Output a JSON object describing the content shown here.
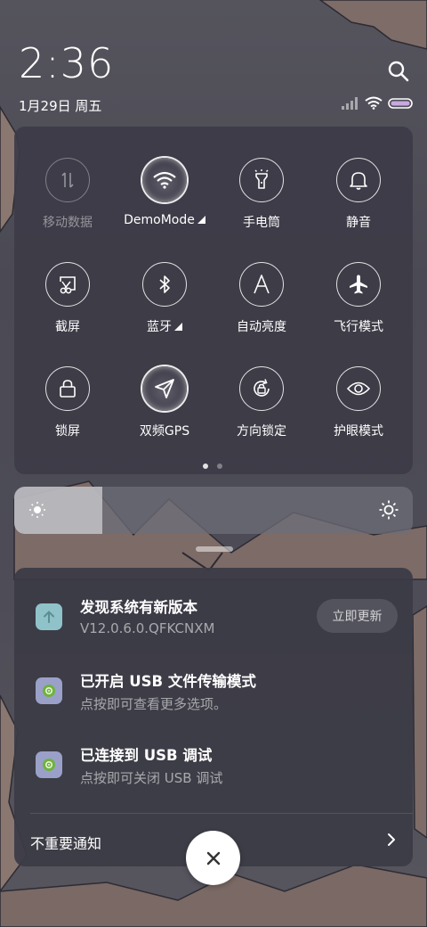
{
  "status_bar": {
    "time": "2:36",
    "date": "1月29日 周五",
    "icons": [
      "signal-icon",
      "wifi-icon",
      "battery-icon"
    ]
  },
  "quick_settings": {
    "tiles": [
      {
        "label": "移动数据",
        "icon": "mobile-data-icon",
        "state": "disabled"
      },
      {
        "label": "DemoMode",
        "icon": "wifi-icon",
        "state": "on",
        "expandable": true
      },
      {
        "label": "手电筒",
        "icon": "flashlight-icon",
        "state": "off"
      },
      {
        "label": "静音",
        "icon": "bell-icon",
        "state": "off"
      },
      {
        "label": "截屏",
        "icon": "screenshot-icon",
        "state": "off"
      },
      {
        "label": "蓝牙",
        "icon": "bluetooth-icon",
        "state": "off",
        "expandable": true
      },
      {
        "label": "自动亮度",
        "icon": "auto-brightness-icon",
        "state": "off"
      },
      {
        "label": "飞行模式",
        "icon": "airplane-icon",
        "state": "off"
      },
      {
        "label": "锁屏",
        "icon": "lock-icon",
        "state": "off"
      },
      {
        "label": "双频GPS",
        "icon": "gps-icon",
        "state": "on"
      },
      {
        "label": "方向锁定",
        "icon": "rotation-lock-icon",
        "state": "off"
      },
      {
        "label": "护眼模式",
        "icon": "eye-icon",
        "state": "off"
      }
    ],
    "page_count": 2,
    "current_page": 1
  },
  "brightness": {
    "level": 0.22
  },
  "notifications": [
    {
      "title": "发现系统有新版本",
      "subtitle": "V12.0.6.0.QFKCNXM",
      "icon": "system-update-icon",
      "action": "立即更新"
    },
    {
      "title": "已开启 USB 文件传输模式",
      "subtitle": "点按即可查看更多选项。",
      "icon": "android-settings-icon"
    },
    {
      "title": "已连接到 USB 调试",
      "subtitle": "点按即可关闭 USB 调试",
      "icon": "android-settings-icon"
    }
  ],
  "unimportant_label": "不重要通知",
  "colors": {
    "panel": "#3c3b46",
    "accent_update": "#8fc3c9",
    "android_icon": "#9aa0c8"
  }
}
